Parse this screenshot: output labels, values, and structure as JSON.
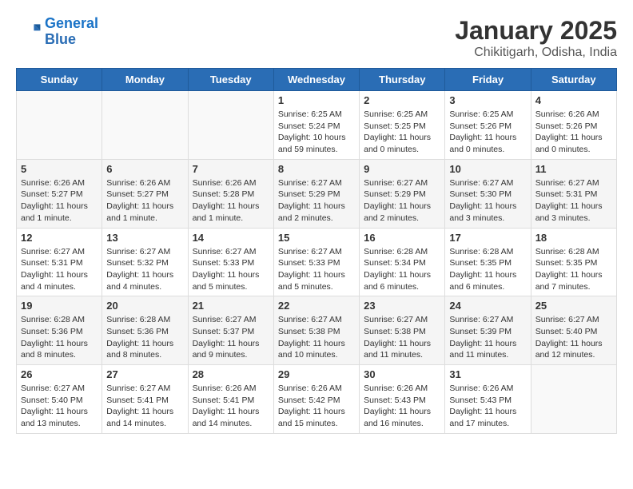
{
  "header": {
    "logo_line1": "General",
    "logo_line2": "Blue",
    "title": "January 2025",
    "subtitle": "Chikitigarh, Odisha, India"
  },
  "weekdays": [
    "Sunday",
    "Monday",
    "Tuesday",
    "Wednesday",
    "Thursday",
    "Friday",
    "Saturday"
  ],
  "weeks": [
    [
      {
        "day": "",
        "lines": []
      },
      {
        "day": "",
        "lines": []
      },
      {
        "day": "",
        "lines": []
      },
      {
        "day": "1",
        "lines": [
          "Sunrise: 6:25 AM",
          "Sunset: 5:24 PM",
          "Daylight: 10 hours",
          "and 59 minutes."
        ]
      },
      {
        "day": "2",
        "lines": [
          "Sunrise: 6:25 AM",
          "Sunset: 5:25 PM",
          "Daylight: 11 hours",
          "and 0 minutes."
        ]
      },
      {
        "day": "3",
        "lines": [
          "Sunrise: 6:25 AM",
          "Sunset: 5:26 PM",
          "Daylight: 11 hours",
          "and 0 minutes."
        ]
      },
      {
        "day": "4",
        "lines": [
          "Sunrise: 6:26 AM",
          "Sunset: 5:26 PM",
          "Daylight: 11 hours",
          "and 0 minutes."
        ]
      }
    ],
    [
      {
        "day": "5",
        "lines": [
          "Sunrise: 6:26 AM",
          "Sunset: 5:27 PM",
          "Daylight: 11 hours",
          "and 1 minute."
        ]
      },
      {
        "day": "6",
        "lines": [
          "Sunrise: 6:26 AM",
          "Sunset: 5:27 PM",
          "Daylight: 11 hours",
          "and 1 minute."
        ]
      },
      {
        "day": "7",
        "lines": [
          "Sunrise: 6:26 AM",
          "Sunset: 5:28 PM",
          "Daylight: 11 hours",
          "and 1 minute."
        ]
      },
      {
        "day": "8",
        "lines": [
          "Sunrise: 6:27 AM",
          "Sunset: 5:29 PM",
          "Daylight: 11 hours",
          "and 2 minutes."
        ]
      },
      {
        "day": "9",
        "lines": [
          "Sunrise: 6:27 AM",
          "Sunset: 5:29 PM",
          "Daylight: 11 hours",
          "and 2 minutes."
        ]
      },
      {
        "day": "10",
        "lines": [
          "Sunrise: 6:27 AM",
          "Sunset: 5:30 PM",
          "Daylight: 11 hours",
          "and 3 minutes."
        ]
      },
      {
        "day": "11",
        "lines": [
          "Sunrise: 6:27 AM",
          "Sunset: 5:31 PM",
          "Daylight: 11 hours",
          "and 3 minutes."
        ]
      }
    ],
    [
      {
        "day": "12",
        "lines": [
          "Sunrise: 6:27 AM",
          "Sunset: 5:31 PM",
          "Daylight: 11 hours",
          "and 4 minutes."
        ]
      },
      {
        "day": "13",
        "lines": [
          "Sunrise: 6:27 AM",
          "Sunset: 5:32 PM",
          "Daylight: 11 hours",
          "and 4 minutes."
        ]
      },
      {
        "day": "14",
        "lines": [
          "Sunrise: 6:27 AM",
          "Sunset: 5:33 PM",
          "Daylight: 11 hours",
          "and 5 minutes."
        ]
      },
      {
        "day": "15",
        "lines": [
          "Sunrise: 6:27 AM",
          "Sunset: 5:33 PM",
          "Daylight: 11 hours",
          "and 5 minutes."
        ]
      },
      {
        "day": "16",
        "lines": [
          "Sunrise: 6:28 AM",
          "Sunset: 5:34 PM",
          "Daylight: 11 hours",
          "and 6 minutes."
        ]
      },
      {
        "day": "17",
        "lines": [
          "Sunrise: 6:28 AM",
          "Sunset: 5:35 PM",
          "Daylight: 11 hours",
          "and 6 minutes."
        ]
      },
      {
        "day": "18",
        "lines": [
          "Sunrise: 6:28 AM",
          "Sunset: 5:35 PM",
          "Daylight: 11 hours",
          "and 7 minutes."
        ]
      }
    ],
    [
      {
        "day": "19",
        "lines": [
          "Sunrise: 6:28 AM",
          "Sunset: 5:36 PM",
          "Daylight: 11 hours",
          "and 8 minutes."
        ]
      },
      {
        "day": "20",
        "lines": [
          "Sunrise: 6:28 AM",
          "Sunset: 5:36 PM",
          "Daylight: 11 hours",
          "and 8 minutes."
        ]
      },
      {
        "day": "21",
        "lines": [
          "Sunrise: 6:27 AM",
          "Sunset: 5:37 PM",
          "Daylight: 11 hours",
          "and 9 minutes."
        ]
      },
      {
        "day": "22",
        "lines": [
          "Sunrise: 6:27 AM",
          "Sunset: 5:38 PM",
          "Daylight: 11 hours",
          "and 10 minutes."
        ]
      },
      {
        "day": "23",
        "lines": [
          "Sunrise: 6:27 AM",
          "Sunset: 5:38 PM",
          "Daylight: 11 hours",
          "and 11 minutes."
        ]
      },
      {
        "day": "24",
        "lines": [
          "Sunrise: 6:27 AM",
          "Sunset: 5:39 PM",
          "Daylight: 11 hours",
          "and 11 minutes."
        ]
      },
      {
        "day": "25",
        "lines": [
          "Sunrise: 6:27 AM",
          "Sunset: 5:40 PM",
          "Daylight: 11 hours",
          "and 12 minutes."
        ]
      }
    ],
    [
      {
        "day": "26",
        "lines": [
          "Sunrise: 6:27 AM",
          "Sunset: 5:40 PM",
          "Daylight: 11 hours",
          "and 13 minutes."
        ]
      },
      {
        "day": "27",
        "lines": [
          "Sunrise: 6:27 AM",
          "Sunset: 5:41 PM",
          "Daylight: 11 hours",
          "and 14 minutes."
        ]
      },
      {
        "day": "28",
        "lines": [
          "Sunrise: 6:26 AM",
          "Sunset: 5:41 PM",
          "Daylight: 11 hours",
          "and 14 minutes."
        ]
      },
      {
        "day": "29",
        "lines": [
          "Sunrise: 6:26 AM",
          "Sunset: 5:42 PM",
          "Daylight: 11 hours",
          "and 15 minutes."
        ]
      },
      {
        "day": "30",
        "lines": [
          "Sunrise: 6:26 AM",
          "Sunset: 5:43 PM",
          "Daylight: 11 hours",
          "and 16 minutes."
        ]
      },
      {
        "day": "31",
        "lines": [
          "Sunrise: 6:26 AM",
          "Sunset: 5:43 PM",
          "Daylight: 11 hours",
          "and 17 minutes."
        ]
      },
      {
        "day": "",
        "lines": []
      }
    ]
  ]
}
